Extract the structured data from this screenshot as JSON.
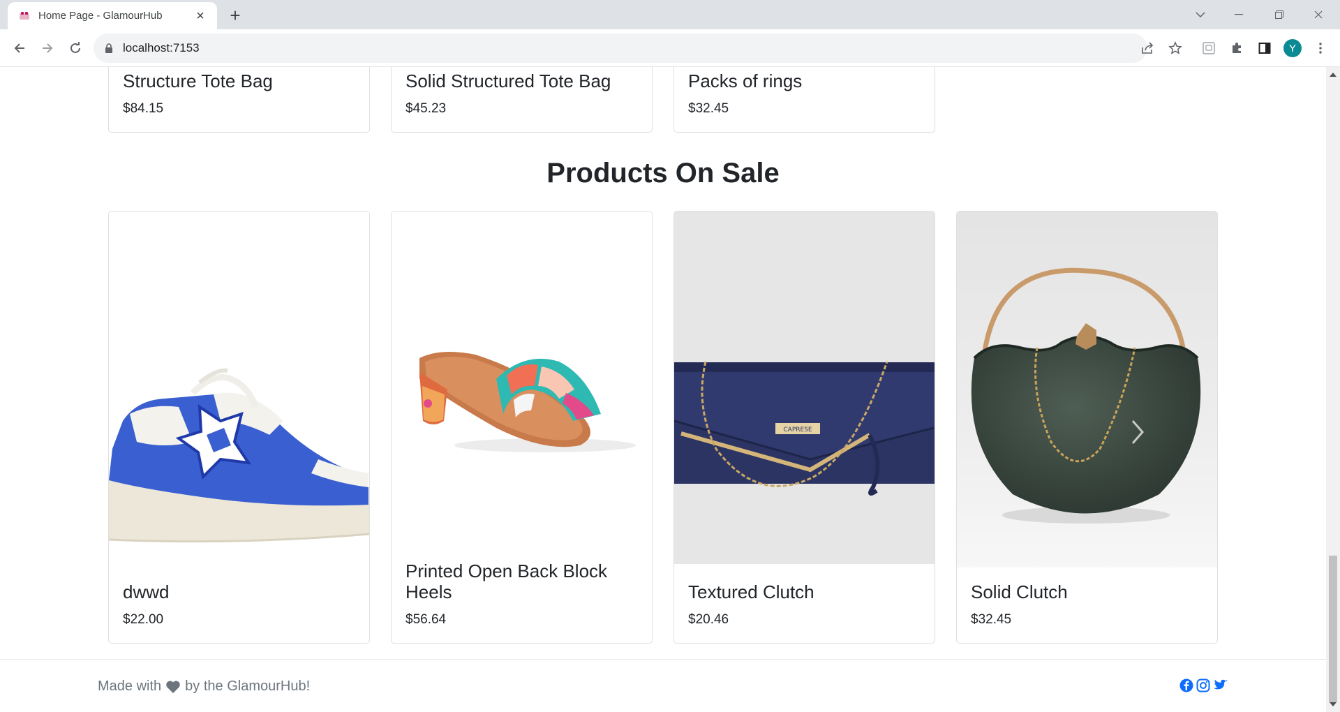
{
  "browser": {
    "tab_title": "Home Page - GlamourHub",
    "url": "localhost:7153",
    "profile_initial": "Y"
  },
  "top_products": [
    {
      "name": "Structure Tote Bag",
      "price": "$84.15"
    },
    {
      "name": "Solid Structured Tote Bag",
      "price": "$45.23"
    },
    {
      "name": "Packs of rings",
      "price": "$32.45"
    }
  ],
  "sale": {
    "title": "Products On Sale",
    "products": [
      {
        "name": "dwwd",
        "price": "$22.00",
        "image": "blue-sneaker"
      },
      {
        "name": "Printed Open Back Block Heels",
        "price": "$56.64",
        "image": "printed-heel-sandal"
      },
      {
        "name": "Textured Clutch",
        "price": "$20.46",
        "image": "navy-clutch"
      },
      {
        "name": "Solid Clutch",
        "price": "$32.45",
        "image": "green-round-clutch"
      }
    ]
  },
  "footer": {
    "made_with": "Made with",
    "by_text": "by the GlamourHub!"
  },
  "colors": {
    "brand_text": "#212529",
    "muted": "#6c757d",
    "social_blue": "#0d6efd"
  }
}
